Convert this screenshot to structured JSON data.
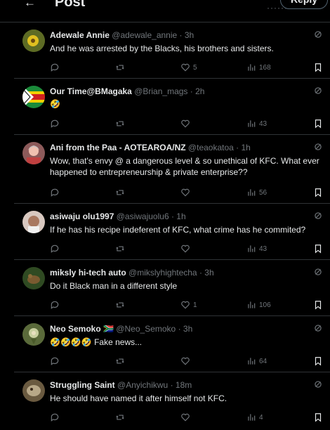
{
  "header": {
    "back_glyph": "←",
    "title": "Post",
    "more": "······",
    "reply_button": "Reply"
  },
  "tweets": [
    {
      "name": "Adewale Annie",
      "handle": "@adewale_annie",
      "time": "· 3h",
      "text": "And he was arrested by the Blacks, his brothers and sisters.",
      "likes": "5",
      "views": "168",
      "avatar_color": "#6a7a2a"
    },
    {
      "name": "Our Time@BMagaka",
      "handle": "@Brian_mags",
      "time": "· 2h",
      "text": "🤣",
      "likes": "",
      "views": "43",
      "avatar_color": "#1f7a3a"
    },
    {
      "name": "Ani from the Paa - AOTEAROA/NZ",
      "handle": "@teaokatoa",
      "time": "· 1h",
      "text": "Wow, that's envy @ a dangerous level & so unethical of KFC. What ever happened to entrepreneurship & private enterprise??",
      "likes": "",
      "views": "56",
      "avatar_color": "#b56a6a"
    },
    {
      "name": "asiwaju olu1997",
      "handle": "@asiwajuolu6",
      "time": "· 1h",
      "text": "If he has his recipe indeferent of KFC, what crime has he commited?",
      "likes": "",
      "views": "43",
      "avatar_color": "#c9a89a"
    },
    {
      "name": "miksly hi-tech auto",
      "handle": "@mikslyhightecha",
      "time": "· 3h",
      "text": "Do it Black man in a different style",
      "likes": "1",
      "views": "106",
      "avatar_color": "#3d5a2a"
    },
    {
      "name": "Neo Semoko",
      "flag": "🇿🇦",
      "handle": "@Neo_Semoko",
      "time": "· 3h",
      "text": "🤣🤣🤣🤣 Fake news...",
      "likes": "",
      "views": "64",
      "avatar_color": "#7d8a5a"
    },
    {
      "name": "Struggling Saint",
      "handle": "@Anyichikwu",
      "time": "· 18m",
      "text": "He should have named it after himself not KFC.",
      "likes": "",
      "views": "4",
      "avatar_color": "#8a7a5a"
    }
  ],
  "icons": {
    "reply": "reply-icon",
    "retweet": "retweet-icon",
    "like": "heart-icon",
    "views": "views-icon",
    "bookmark": "bookmark-icon",
    "grok": "grok-icon"
  }
}
